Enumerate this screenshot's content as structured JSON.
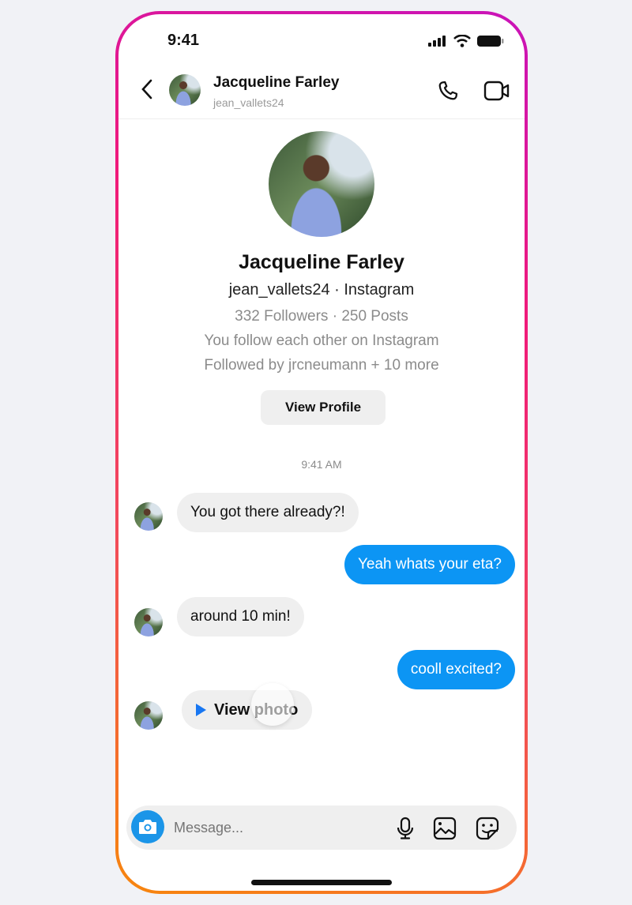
{
  "status_bar": {
    "time": "9:41"
  },
  "header": {
    "name": "Jacqueline Farley",
    "username": "jean_vallets24",
    "icons": [
      "back-chevron-icon",
      "phone-icon",
      "video-camera-icon"
    ]
  },
  "profile": {
    "name": "Jacqueline Farley",
    "username_line": "jean_vallets24 · Instagram",
    "stats": "332 Followers · 250 Posts",
    "mutual": "You follow each other on Instagram",
    "followed_by": "Followed by jrcneumann + 10 more",
    "view_profile_label": "View Profile"
  },
  "conversation": {
    "timestamp": "9:41 AM",
    "messages": [
      {
        "from": "them",
        "text": "You got there already?!"
      },
      {
        "from": "me",
        "text": "Yeah whats your eta?"
      },
      {
        "from": "them",
        "text": "around 10 min!"
      },
      {
        "from": "me",
        "text": "cooll excited?"
      },
      {
        "from": "them",
        "text": "View photo",
        "type": "photo"
      }
    ]
  },
  "composer": {
    "placeholder": "Message...",
    "icons": [
      "camera-icon",
      "microphone-icon",
      "gallery-icon",
      "sticker-icon"
    ]
  },
  "colors": {
    "accent_blue": "#0c95f4",
    "play_blue": "#1877f2",
    "incoming_bubble": "#efefef"
  }
}
